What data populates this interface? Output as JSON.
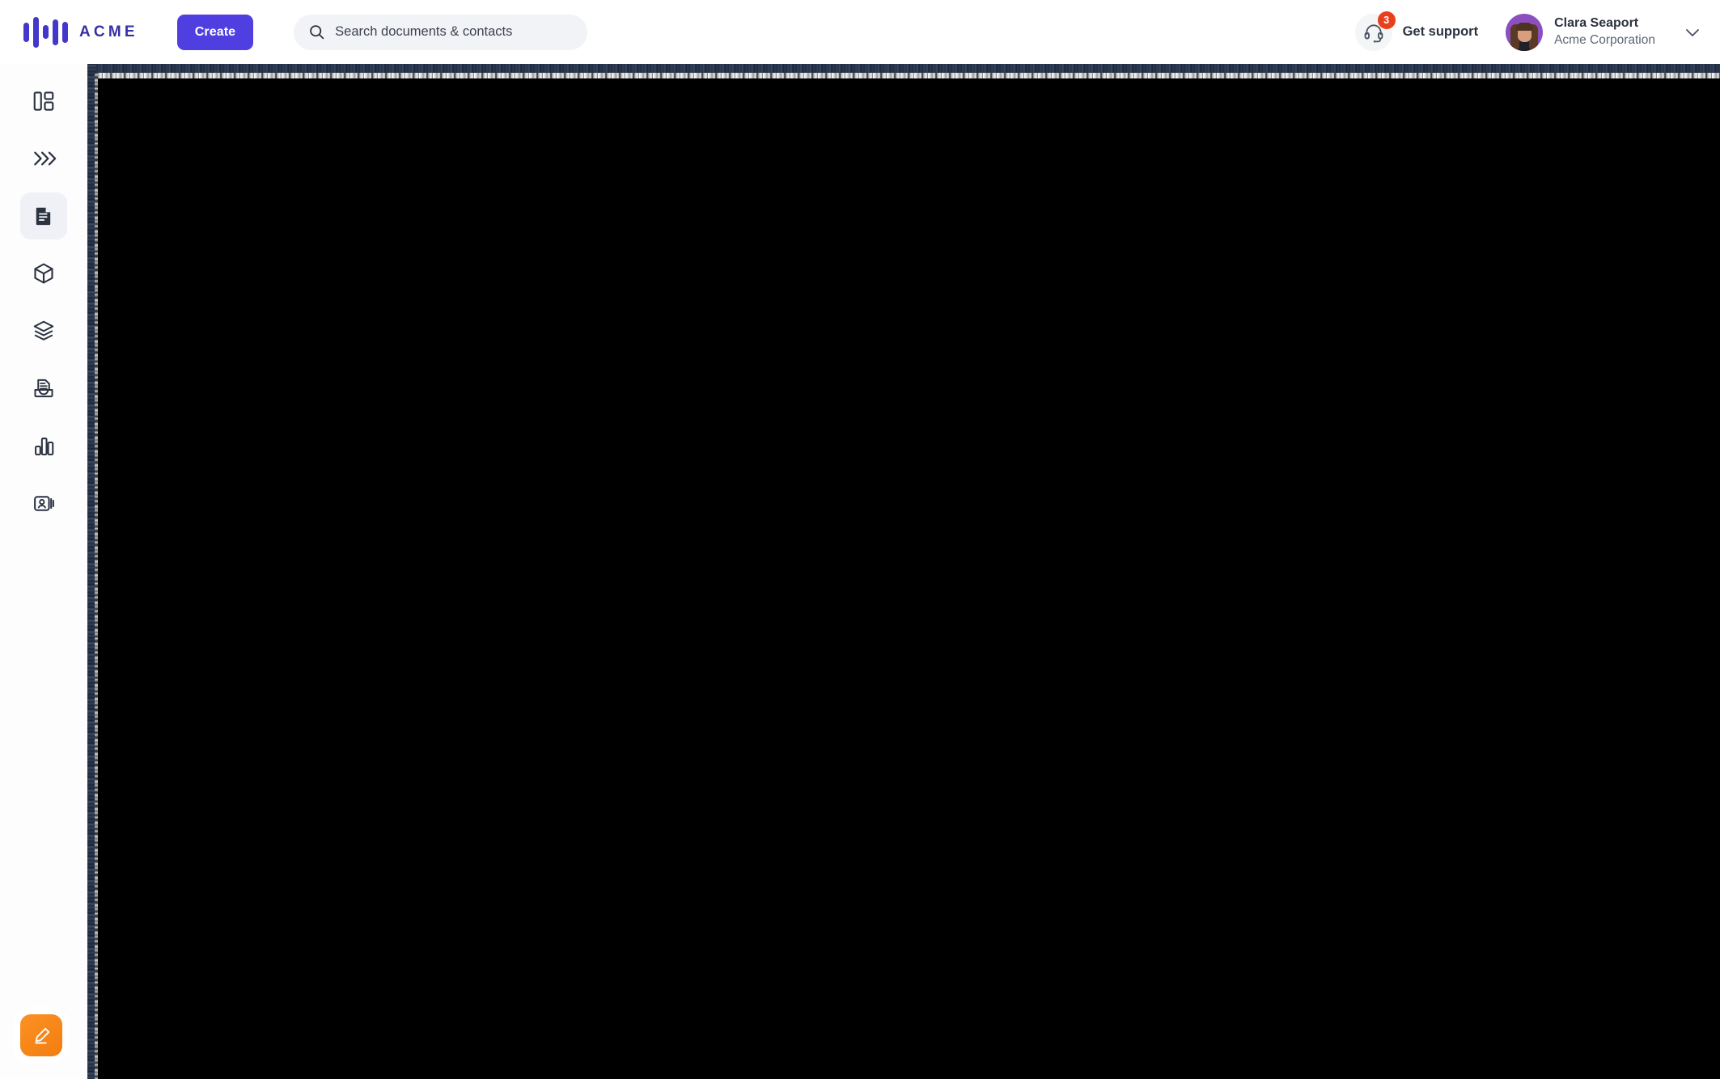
{
  "app": {
    "brand_name": "ACME",
    "brand_color": "#4338ca",
    "accent_color": "#4f3fe0",
    "compose_color": "#f47c10",
    "badge_color": "#e8401c"
  },
  "header": {
    "logo_icon": "acme-waveform-logo",
    "create_label": "Create",
    "search": {
      "icon": "search-icon",
      "placeholder": "Search documents & contacts",
      "value": ""
    },
    "support": {
      "icon": "headset-icon",
      "label": "Get support",
      "badge_count": "3"
    },
    "user": {
      "avatar_icon": "user-avatar",
      "name": "Clara Seaport",
      "organization": "Acme Corporation",
      "chevron_icon": "chevron-down-icon"
    }
  },
  "sidebar": {
    "items": [
      {
        "icon": "dashboard-layout-icon",
        "name": "dashboard",
        "active": false
      },
      {
        "icon": "double-chevron-right-icon",
        "name": "workflows",
        "active": false
      },
      {
        "icon": "document-icon",
        "name": "documents",
        "active": true
      },
      {
        "icon": "cube-icon",
        "name": "packages",
        "active": false
      },
      {
        "icon": "layers-icon",
        "name": "templates",
        "active": false
      },
      {
        "icon": "inbox-document-icon",
        "name": "inbox",
        "active": false
      },
      {
        "icon": "bar-chart-icon",
        "name": "reports",
        "active": false
      },
      {
        "icon": "contact-card-icon",
        "name": "contacts",
        "active": false
      }
    ],
    "compose": {
      "icon": "pencil-sign-icon",
      "name": "compose"
    }
  },
  "main": {
    "state": "blank",
    "background_color": "#000000",
    "frame_color": "#273245"
  }
}
